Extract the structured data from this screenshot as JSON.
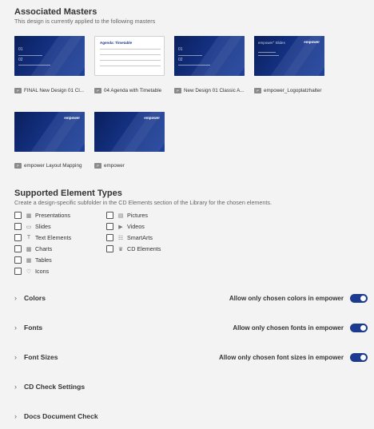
{
  "masters": {
    "title": "Associated Masters",
    "subtitle": "This design is currently applied to the following masters",
    "items": [
      {
        "label": "FINAL New Design 01 Cl...",
        "thumb_text": "01",
        "thumb_sub": "02"
      },
      {
        "label": "04 Agenda with Timetable",
        "thumb_text": "Agenda: Timetable"
      },
      {
        "label": "New Design 01 Classic A...",
        "thumb_text": "01",
        "thumb_sub": "02"
      },
      {
        "label": "empower_Logoplatzhalter",
        "thumb_text": "empower° Slides",
        "thumb_brand": "empower"
      },
      {
        "label": "empower Layout Mapping",
        "thumb_brand": "empower"
      },
      {
        "label": "empower",
        "thumb_brand": "empower"
      }
    ]
  },
  "elements": {
    "title": "Supported Element Types",
    "subtitle": "Create a design-specific subfolder in the CD Elements section of the Library for the chosen elements.",
    "col1": [
      {
        "label": "Presentations",
        "icon": "presentation-icon"
      },
      {
        "label": "Slides",
        "icon": "slide-icon"
      },
      {
        "label": "Text Elements",
        "icon": "text-element-icon"
      },
      {
        "label": "Charts",
        "icon": "chart-icon"
      },
      {
        "label": "Tables",
        "icon": "table-icon"
      },
      {
        "label": "Icons",
        "icon": "icons-icon"
      }
    ],
    "col2": [
      {
        "label": "Pictures",
        "icon": "picture-icon"
      },
      {
        "label": "Videos",
        "icon": "video-icon"
      },
      {
        "label": "SmartArts",
        "icon": "smartart-icon"
      },
      {
        "label": "CD Elements",
        "icon": "cd-elements-icon"
      }
    ]
  },
  "sections": [
    {
      "title": "Colors",
      "toggle_label": "Allow only chosen colors in empower",
      "toggle_on": true
    },
    {
      "title": "Fonts",
      "toggle_label": "Allow only chosen fonts in empower",
      "toggle_on": true
    },
    {
      "title": "Font Sizes",
      "toggle_label": "Allow only chosen font sizes in empower",
      "toggle_on": true
    },
    {
      "title": "CD Check Settings"
    },
    {
      "title": "Docs Document Check"
    }
  ],
  "colors": {
    "accent": "#1d3b8e",
    "thumb_blue": "#102a6a"
  }
}
